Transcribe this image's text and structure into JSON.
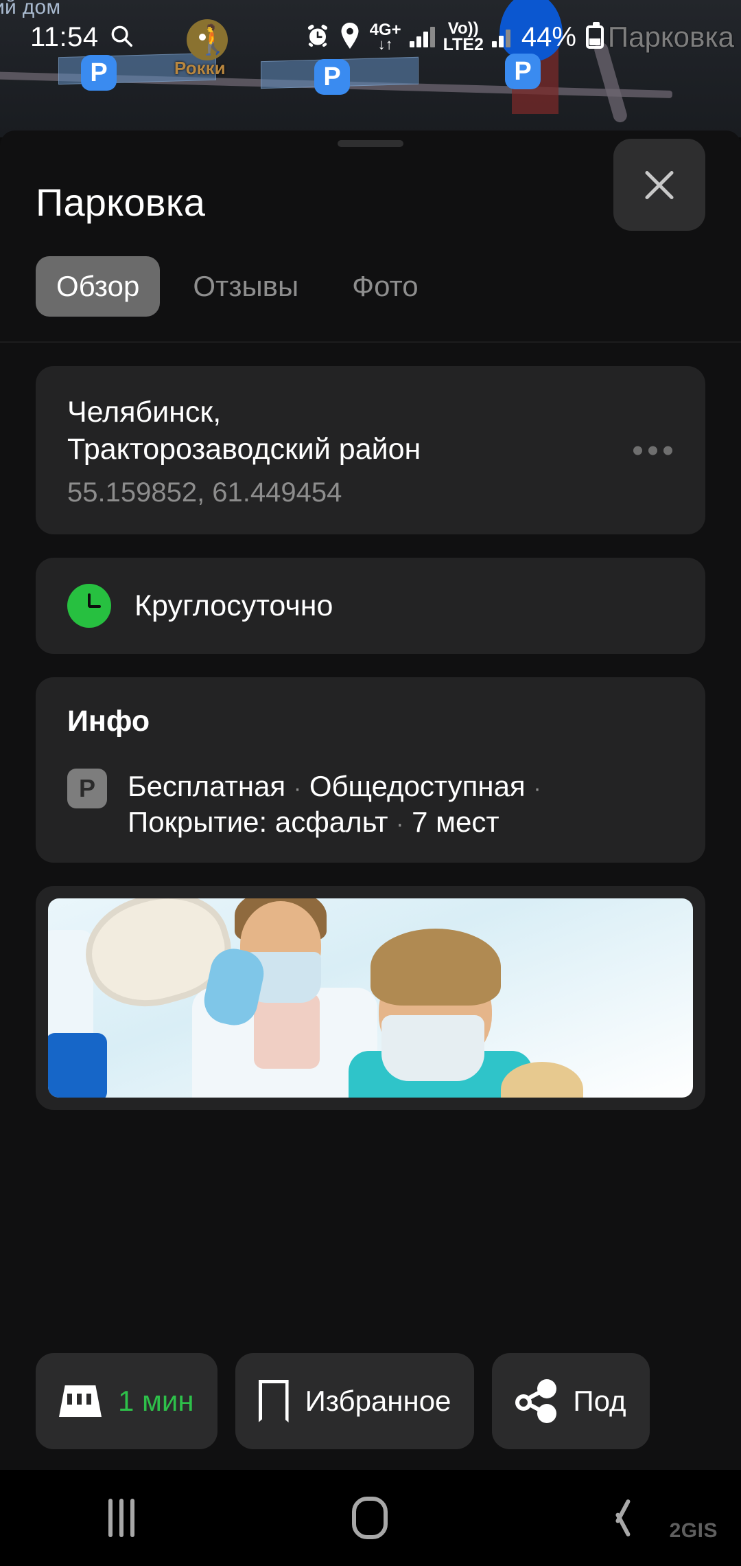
{
  "status_bar": {
    "time": "11:54",
    "search_icon": "search-icon",
    "rocky_label": "Рокки",
    "alarm_icon": "alarm-icon",
    "location_icon": "location-pin-icon",
    "network_type": "4G+",
    "data_arrows": "↓↑",
    "volte_line1": "Vo))",
    "volte_line2": "LTE2",
    "battery_percent": "44%",
    "app_name": "Парковка"
  },
  "map": {
    "house_label": "ий дом",
    "parking_badge": "P"
  },
  "sheet": {
    "title": "Парковка",
    "close_label": "close-icon",
    "tabs": [
      {
        "label": "Обзор",
        "active": true
      },
      {
        "label": "Отзывы",
        "active": false
      },
      {
        "label": "Фото",
        "active": false
      }
    ],
    "address": {
      "line1": "Челябинск,",
      "line2": "Тракторозаводский район",
      "coords": "55.159852, 61.449454",
      "menu_icon": "kebab-menu-icon"
    },
    "hours": {
      "icon": "clock-icon",
      "text": "Круглосуточно",
      "accent_color": "#27c040"
    },
    "info": {
      "heading": "Инфо",
      "icon": "parking-p-icon",
      "line1": "Бесплатная",
      "sep1": "·",
      "line2": "Общедоступная",
      "sep2": "·",
      "line3": "Покрытие: асфальт",
      "sep3": "·",
      "line4": "7 мест"
    },
    "promo": {
      "alt": "dental-clinic-advertisement-photo"
    }
  },
  "action_bar": {
    "taxi": {
      "icon": "taxi-icon",
      "label": "1 мин",
      "color": "#2ec04a"
    },
    "favorite": {
      "icon": "bookmark-icon",
      "label": "Избранное"
    },
    "share": {
      "icon": "share-icon",
      "label": "Под"
    }
  },
  "nav_bar": {
    "recents": "recents-icon",
    "home": "home-icon",
    "back": "back-icon",
    "watermark": "2GIS"
  }
}
